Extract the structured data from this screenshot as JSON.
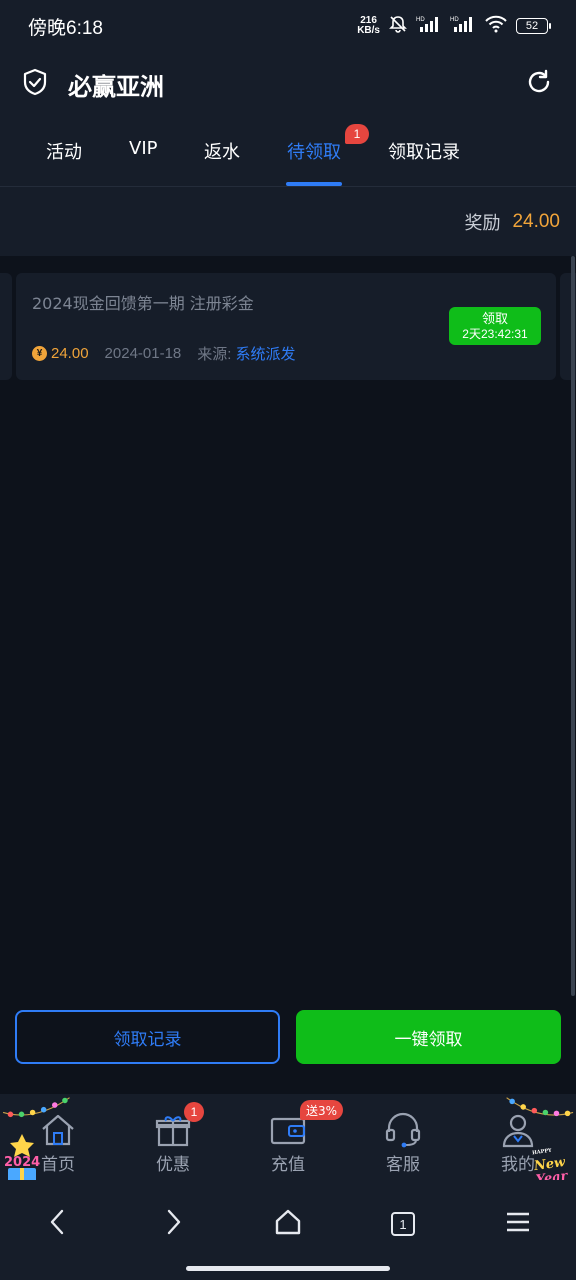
{
  "status_bar": {
    "time": "傍晚6:18",
    "net_speed_value": "216",
    "net_speed_unit": "KB/s",
    "battery": "52"
  },
  "header": {
    "title": "必赢亚洲"
  },
  "tabs": [
    {
      "label": "活动"
    },
    {
      "label": "VIP"
    },
    {
      "label": "返水"
    },
    {
      "label": "待领取",
      "badge": "1",
      "active": true
    },
    {
      "label": "领取记录"
    }
  ],
  "reward_summary": {
    "label": "奖励",
    "value": "24.00"
  },
  "rewards": [
    {
      "title": "2024现金回馈第一期 注册彩金",
      "currency_icon": "¥",
      "amount": "24.00",
      "date": "2024-01-18",
      "source_label": "来源:",
      "source": "系统派发",
      "claim_label": "领取",
      "countdown": "2天23:42:31"
    }
  ],
  "actions": {
    "records_label": "领取记录",
    "claim_all_label": "一键领取"
  },
  "bottom_nav": {
    "items": [
      {
        "label": "首页",
        "icon": "home-icon"
      },
      {
        "label": "优惠",
        "icon": "gift-icon",
        "badge": "1"
      },
      {
        "label": "充值",
        "icon": "wallet-icon",
        "promo": "送3%"
      },
      {
        "label": "客服",
        "icon": "headset-icon"
      },
      {
        "label": "我的",
        "icon": "user-icon"
      }
    ],
    "deco_year": "2024",
    "deco_happy": "HAPPY",
    "deco_new": "New",
    "deco_year_word": "Year"
  },
  "system_nav": {
    "tab_count": "1"
  },
  "colors": {
    "background": "#0d121b",
    "surface": "#161d29",
    "accent_blue": "#2f7cf6",
    "accent_green": "#0fbd19",
    "gold": "#f0a43a",
    "badge_red": "#e6463f"
  }
}
